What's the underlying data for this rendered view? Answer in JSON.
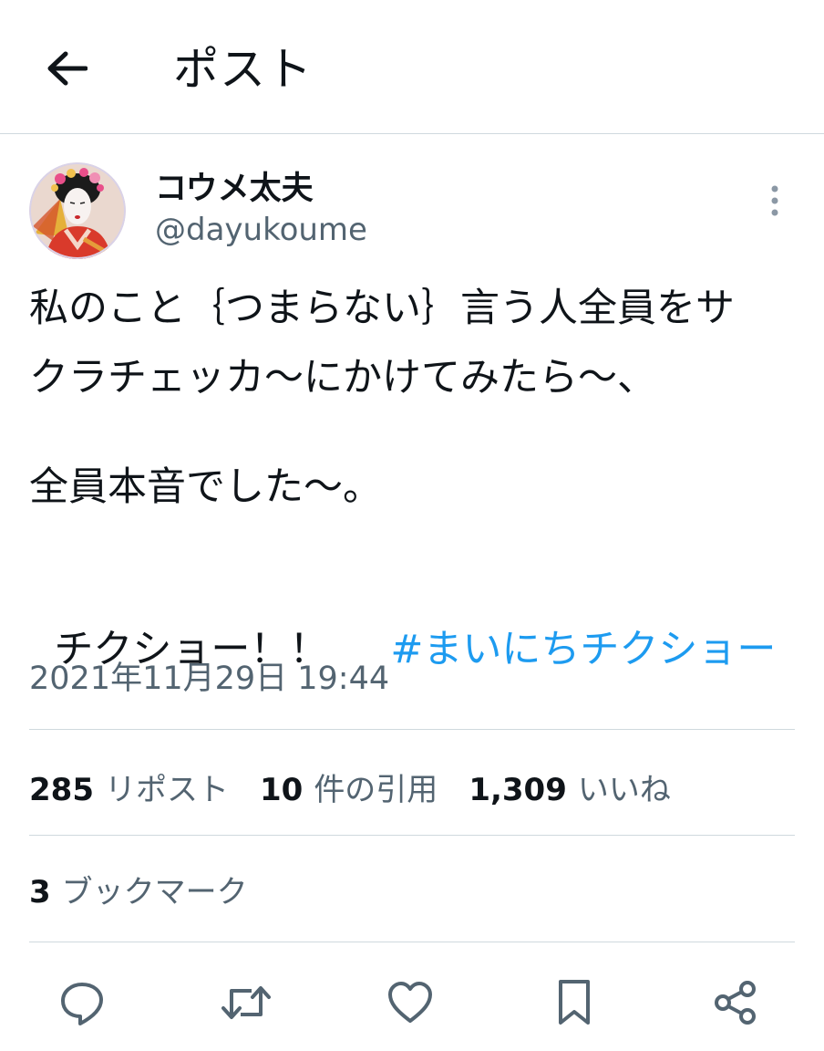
{
  "header": {
    "title": "ポスト",
    "back_icon": "arrow-left-icon"
  },
  "author": {
    "display_name": "コウメ太夫",
    "handle": "@dayukoume",
    "avatar_icon": "avatar-image"
  },
  "post": {
    "lines": [
      "私のこと｛つまらない｝言う人全員をサ",
      "クラチェッカ〜にかけてみたら〜、",
      "全員本音でした〜。"
    ],
    "last_line_text": "チクショー！！",
    "hashtag": "#まいにちチクショー",
    "timestamp": "2021年11月29日 19:44"
  },
  "stats": {
    "reposts_count": "285",
    "reposts_label": "リポスト",
    "quotes_count": "10",
    "quotes_label": "件の引用",
    "likes_count": "1,309",
    "likes_label": "いいね",
    "bookmarks_count": "3",
    "bookmarks_label": "ブックマーク"
  },
  "actions": {
    "reply_icon": "reply-icon",
    "repost_icon": "repost-icon",
    "like_icon": "heart-icon",
    "bookmark_icon": "bookmark-icon",
    "share_icon": "share-icon"
  },
  "colors": {
    "link": "#1d9bf0",
    "secondary_text": "#536471",
    "divider": "#cfd9de",
    "icon": "#536471"
  }
}
